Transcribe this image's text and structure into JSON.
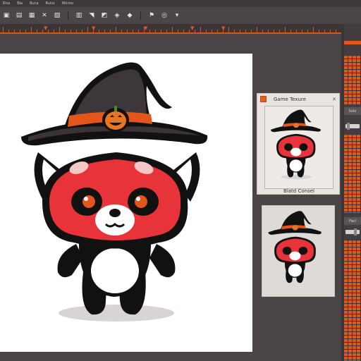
{
  "menu": {
    "items": [
      "Eisa",
      "Bia",
      "Buca",
      "Ruiss",
      "Wicioo"
    ]
  },
  "toolbar": {
    "buttons": [
      {
        "icon": "square-icon",
        "glyph": "▣"
      },
      {
        "icon": "box-icon",
        "glyph": "▤"
      },
      {
        "icon": "grid-icon",
        "glyph": "▦"
      },
      {
        "icon": "cross-icon",
        "glyph": "✕"
      },
      {
        "icon": "view-icon",
        "glyph": "▧"
      },
      {
        "icon": "layer-icon",
        "glyph": "▥"
      },
      {
        "icon": "pointer-icon",
        "glyph": "◥"
      },
      {
        "icon": "image-icon",
        "glyph": "◩"
      },
      {
        "icon": "diamond-icon",
        "glyph": "◈"
      },
      {
        "icon": "diamond2-icon",
        "glyph": "◆"
      },
      {
        "icon": "brush-icon",
        "glyph": "⚑"
      },
      {
        "icon": "target-icon",
        "glyph": "◎"
      },
      {
        "icon": "down-icon",
        "glyph": "▾"
      }
    ]
  },
  "preview_panel": {
    "title": "Game Texure",
    "close_glyph": "✕",
    "caption": "Blatd Consel"
  },
  "dock": {
    "solo_label": "Solo",
    "field_label": "Fieil"
  },
  "colors": {
    "accent": "#e0581c",
    "canvas": "#ffffff",
    "ui_bg": "#4a4446"
  }
}
